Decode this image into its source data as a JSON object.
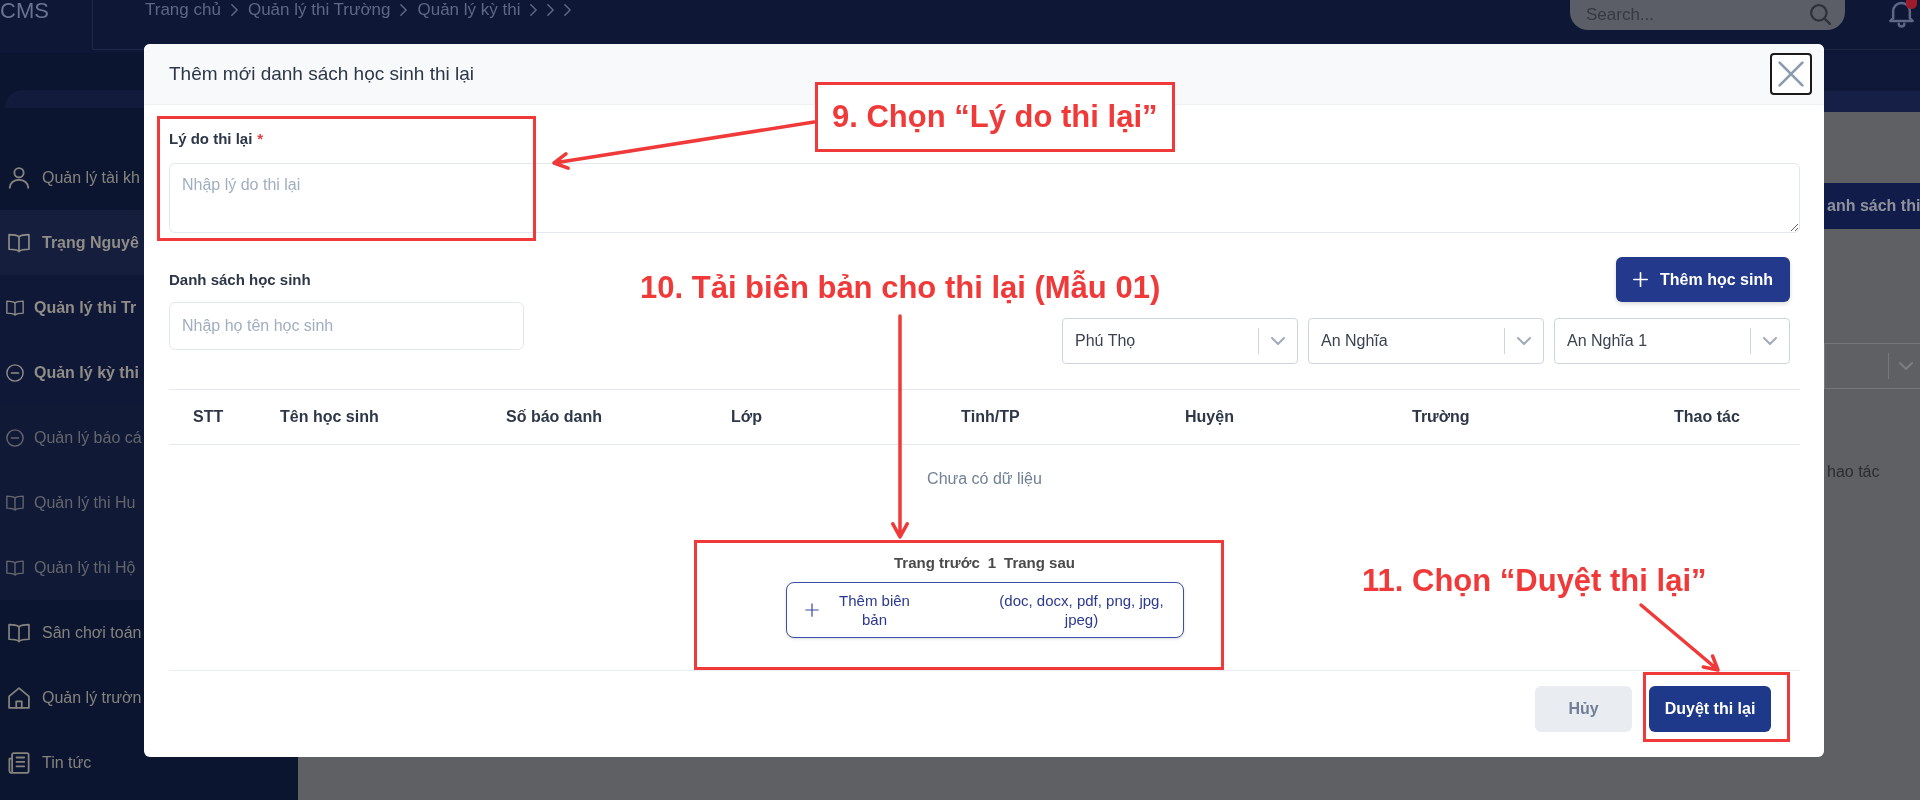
{
  "header": {
    "brand": "CMS",
    "breadcrumb": [
      "Trang chủ",
      "Quản lý thi Trường",
      "Quản lý kỳ thi"
    ],
    "search": {
      "placeholder": "Search..."
    }
  },
  "sidebar": {
    "items": [
      {
        "label": "Quản lý tài kh",
        "selected": false
      },
      {
        "label": "Trạng Nguyê",
        "selected": true,
        "children": [
          {
            "label": "Quản lý thi Tr",
            "selected": true
          },
          {
            "label": "Quản lý kỳ thi",
            "selected": true
          },
          {
            "label": "Quản lý báo cá",
            "selected": false
          },
          {
            "label": "Quản lý thi Hu",
            "selected": false
          },
          {
            "label": "Quản lý thi Hộ",
            "selected": false
          }
        ]
      },
      {
        "label": "Sân chơi toán",
        "selected": false
      },
      {
        "label": "Quản lý trườn",
        "selected": false
      },
      {
        "label": "Tin tức",
        "selected": false
      }
    ]
  },
  "background": {
    "button": "anh sách thi",
    "column_header": "hao tác"
  },
  "modal": {
    "title": "Thêm mới danh sách học sinh thi lại",
    "reason": {
      "label": "Lý do thi lại",
      "required_mark": "*",
      "placeholder": "Nhập lý do thi lại"
    },
    "students": {
      "label": "Danh sách học sinh",
      "add_button": "Thêm học sinh",
      "search": {
        "placeholder": "Nhập họ tên học sinh"
      },
      "filters": [
        {
          "value": "Phú Thọ"
        },
        {
          "value": "An Nghĩa"
        },
        {
          "value": "An Nghĩa 1"
        }
      ]
    },
    "table": {
      "columns": [
        "STT",
        "Tên học sinh",
        "Số báo danh",
        "Lớp",
        "Tỉnh/TP",
        "Huyện",
        "Trường",
        "Thao tác"
      ],
      "empty_text": "Chưa có dữ liệu"
    },
    "pagination": {
      "previous": "Trang trước",
      "page": "1",
      "next": "Trang sau"
    },
    "upload": {
      "label": "Thêm biên bản",
      "formats": "(doc, docx, pdf, png, jpg, jpeg)"
    },
    "buttons": [
      {
        "label": "Hủy",
        "kind": "secondary"
      },
      {
        "label": "Duyệt thi lại",
        "kind": "primary"
      }
    ]
  },
  "annotations": [
    {
      "text": "9. Chọn “Lý do thi lại”",
      "boxed": true
    },
    {
      "text": "10. Tải biên bản cho thi lại (Mẫu 01)",
      "boxed": false
    },
    {
      "text": "11. Chọn “Duyệt thi lại”",
      "boxed": false
    }
  ]
}
